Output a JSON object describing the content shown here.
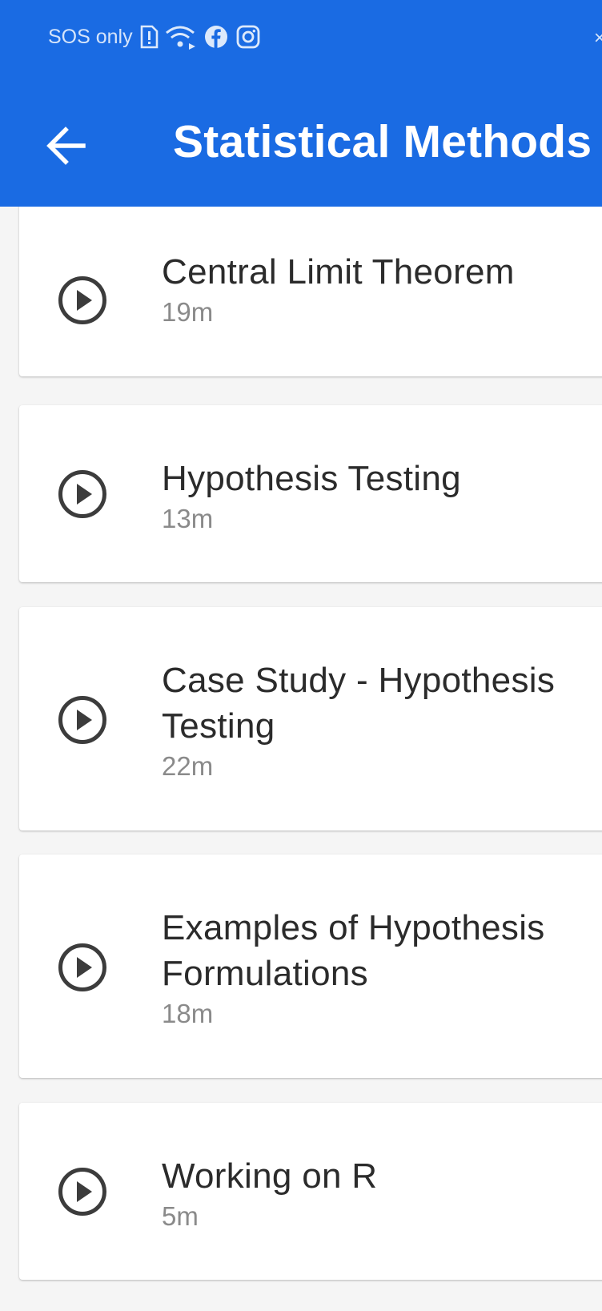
{
  "status_bar": {
    "carrier_text": "SOS only",
    "icons": [
      "sim-alert-icon",
      "wifi-icon",
      "facebook-icon",
      "instagram-icon"
    ]
  },
  "toolbar": {
    "title": "Statistical Methods",
    "back_icon": "arrow-back-icon"
  },
  "colors": {
    "app_bar": "#1a6be3",
    "card_background": "#ffffff",
    "title_text": "#2b2b2b",
    "duration_text": "#8a8a8a",
    "icon": "#3c3c3c"
  },
  "lessons": [
    {
      "title": "Central Limit Theorem",
      "duration": "19m",
      "icon": "play-circle-icon"
    },
    {
      "title": "Hypothesis Testing",
      "duration": "13m",
      "icon": "play-circle-icon"
    },
    {
      "title": "Case Study - Hypothesis Testing",
      "duration": "22m",
      "icon": "play-circle-icon"
    },
    {
      "title": "Examples of Hypothesis Formulations",
      "duration": "18m",
      "icon": "play-circle-icon"
    },
    {
      "title": "Working on R",
      "duration": "5m",
      "icon": "play-circle-icon"
    }
  ]
}
